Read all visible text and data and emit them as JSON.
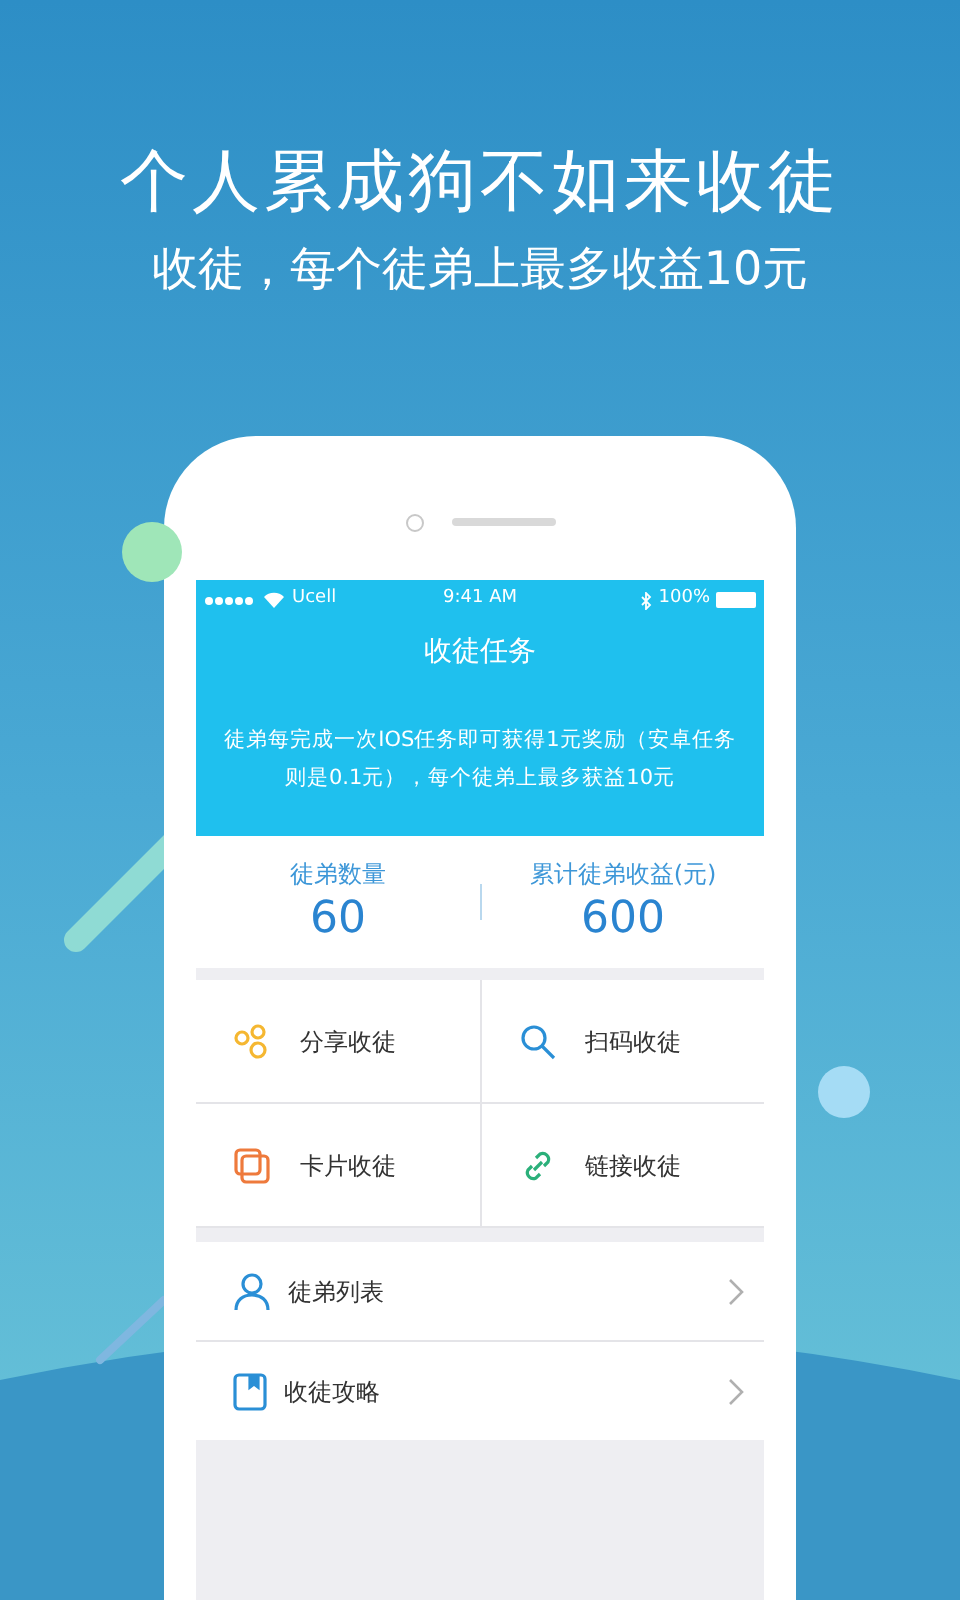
{
  "headline": "个人累成狗不如来收徒",
  "subheadline": "收徒，每个徒弟上最多收益10元",
  "status_bar": {
    "carrier": "Ucell",
    "time": "9:41 AM",
    "battery": "100%"
  },
  "nav": {
    "title": "收徒任务"
  },
  "banner": {
    "text": "徒弟每完成一次IOS任务即可获得1元奖励（安卓任务则是0.1元），每个徒弟上最多获益10元"
  },
  "stats": [
    {
      "label": "徒弟数量",
      "value": "60"
    },
    {
      "label": "累计徒弟收益(元)",
      "value": "600"
    }
  ],
  "actions": [
    {
      "kind": "share",
      "label": "分享收徒",
      "color": "#f5b731"
    },
    {
      "kind": "scan",
      "label": "扫码收徒",
      "color": "#2a8fd6"
    },
    {
      "kind": "card",
      "label": "卡片收徒",
      "color": "#ee7a3c"
    },
    {
      "kind": "link",
      "label": "链接收徒",
      "color": "#2bb07a"
    }
  ],
  "menu": [
    {
      "kind": "person",
      "label": "徒弟列表"
    },
    {
      "kind": "book",
      "label": "收徒攻略"
    }
  ]
}
